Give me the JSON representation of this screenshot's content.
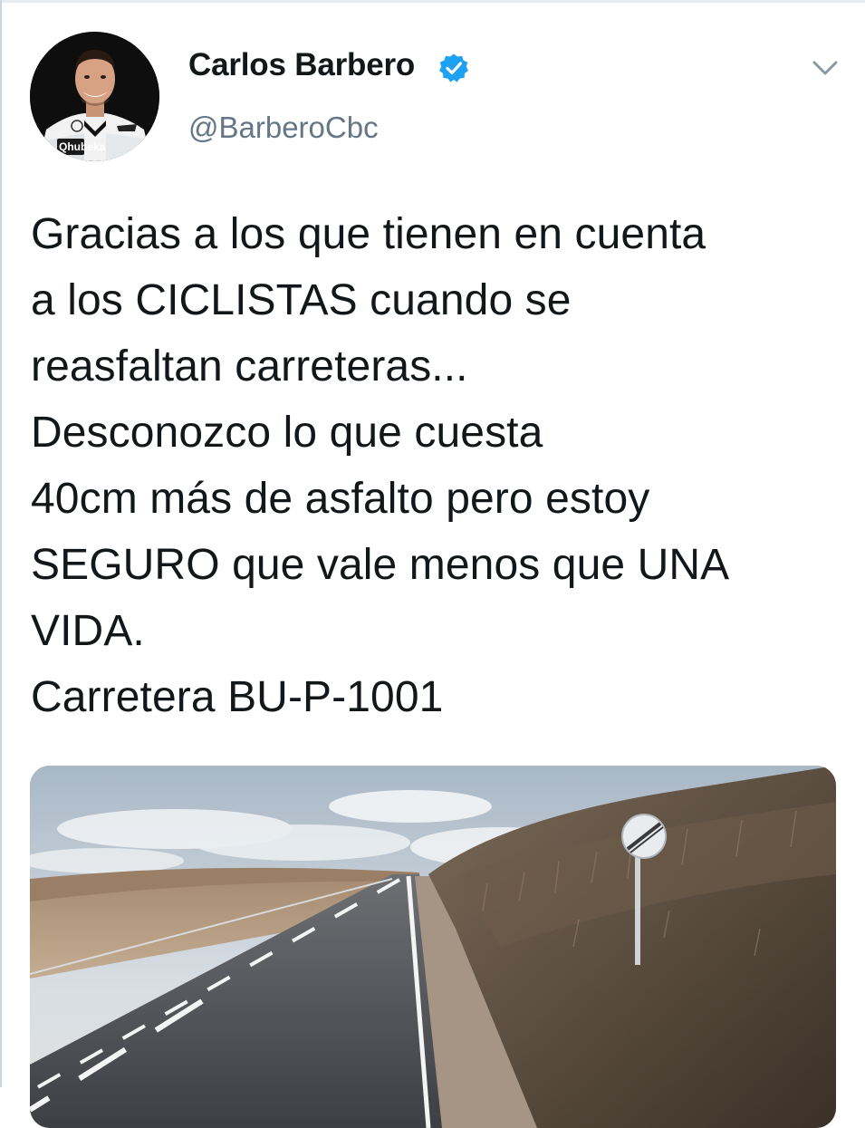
{
  "tweet": {
    "author": {
      "name": "Carlos Barbero",
      "handle": "@BarberoCbc",
      "verified": true,
      "avatar_text": "Qhubeka"
    },
    "text": "Gracias a los que tienen en cuenta\na los CICLISTAS cuando se\nreasfaltan carreteras...\nDesconozco lo que cuesta\n40cm más de asfalto pero estoy\nSEGURO que vale menos que UNA\nVIDA.\nCarretera BU-P-1001",
    "icons": {
      "verified": "verified-badge-icon",
      "menu": "chevron-down-icon"
    },
    "media": {
      "description_icon": "road-photo"
    }
  },
  "colors": {
    "verified_blue": "#1da1f2",
    "handle_gray": "#657786",
    "text": "#14171a"
  }
}
